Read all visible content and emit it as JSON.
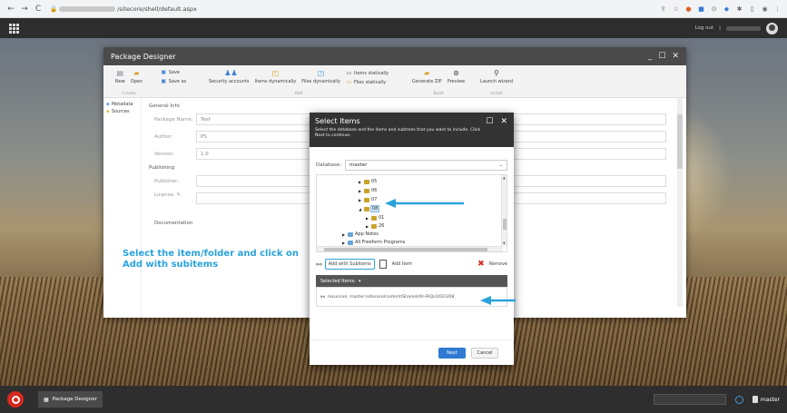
{
  "browser": {
    "url_tail": "/sitecore/shell/default.aspx"
  },
  "topbar": {
    "logout_label": "Log out"
  },
  "package_designer": {
    "title": "Package Designer",
    "ribbon": {
      "new_label": "New",
      "open_label": "Open",
      "create_group": "Create",
      "save_label": "Save",
      "save_as_label": "Save as",
      "security_accounts_label": "Security accounts",
      "items_dynamically_label": "Items dynamically",
      "files_dynamically_label": "Files dynamically",
      "items_statically_label": "Items statically",
      "files_statically_label": "Files statically",
      "add_group": "Add",
      "generate_zip_label": "Generate ZIP",
      "preview_label": "Preview",
      "build_group": "Build",
      "launch_wizard_label": "Launch wizard",
      "install_group": "Install"
    },
    "sidebar": {
      "metadata_label": "Metadata",
      "sources_label": "Sources"
    },
    "general_info_heading": "General Info",
    "fields": {
      "package_name_label": "Package Name:",
      "package_name_value": "Test",
      "author_label": "Author:",
      "author_value": "PS",
      "version_label": "Version:",
      "version_value": "1.0",
      "publishing_heading": "Publishing",
      "publisher_label": "Publisher:",
      "license_label": "License:",
      "documentation_heading": "Documentation"
    }
  },
  "annotation": {
    "text": "Select the item/folder and click on Add with subitems"
  },
  "dialog": {
    "title": "Select Items",
    "description": "Select the database and the items and subtrees that you want to include. Click Next to continue.",
    "database_label": "Database:",
    "database_value": "master",
    "tree": {
      "n05": "05",
      "n06": "06",
      "n07": "07",
      "n08": "08",
      "n01": "01",
      "n26": "26",
      "app_notes": "App Notes",
      "all_freeform": "All Freeform Programs"
    },
    "add_with_subitems_label": "Add with Subitems",
    "add_item_label": "Add Item",
    "remove_label": "Remove",
    "selected_items_header": "Selected Items:",
    "selected_item_path": "recursive, master:/sitecore/content/Shared/All-FAQs/2023/08",
    "next_label": "Next",
    "cancel_label": "Cancel"
  },
  "taskbar": {
    "task_label": "Package Designer",
    "database_indicator": "master"
  },
  "colors": {
    "accent_blue": "#2aa3dc",
    "next_button": "#2e7bd1",
    "remove_red": "#d6281f",
    "title_bar": "#4a4a4a"
  }
}
